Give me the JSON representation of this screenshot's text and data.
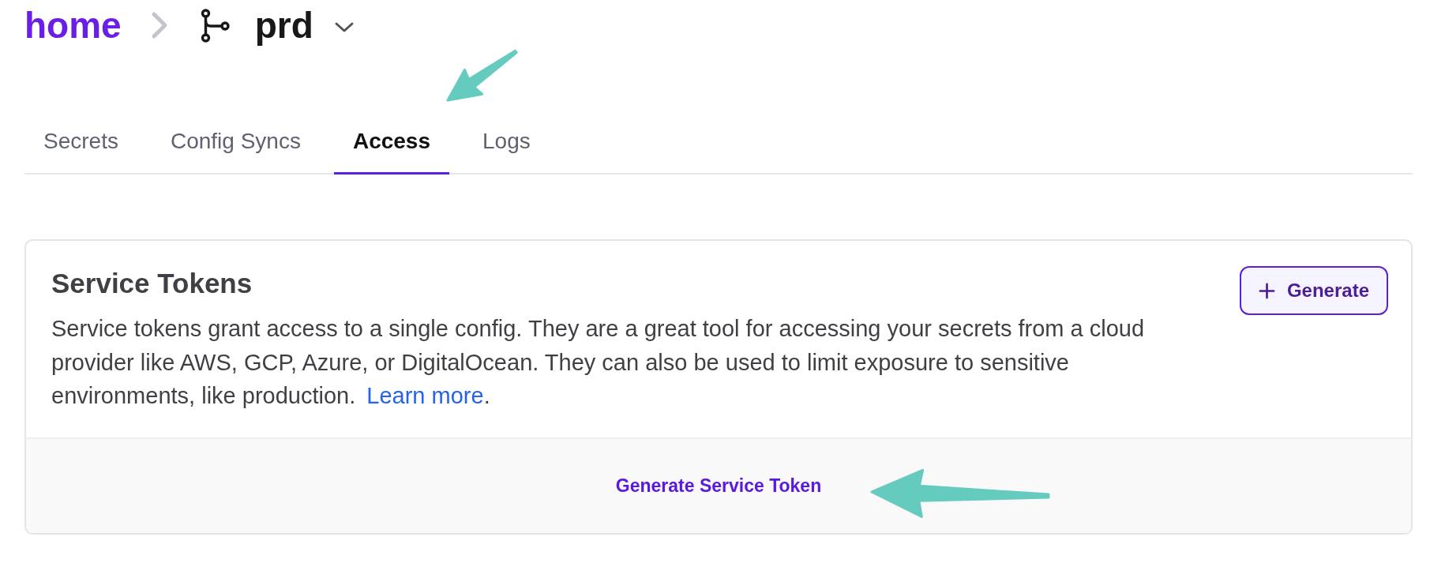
{
  "breadcrumb": {
    "root": "home",
    "project": "prd"
  },
  "tabs": [
    {
      "label": "Secrets",
      "selected": false
    },
    {
      "label": "Config Syncs",
      "selected": false
    },
    {
      "label": "Access",
      "selected": true
    },
    {
      "label": "Logs",
      "selected": false
    }
  ],
  "service_tokens": {
    "title": "Service Tokens",
    "description": {
      "text": "Service tokens grant access to a single config. They are a great tool for accessing your secrets from a cloud provider like AWS, GCP, Azure, or DigitalOcean. They can also be used to limit exposure to sensitive environments, like production.",
      "link": "Learn more",
      "after": "."
    },
    "generate_button": "Generate",
    "footer_action": "Generate Service Token"
  }
}
